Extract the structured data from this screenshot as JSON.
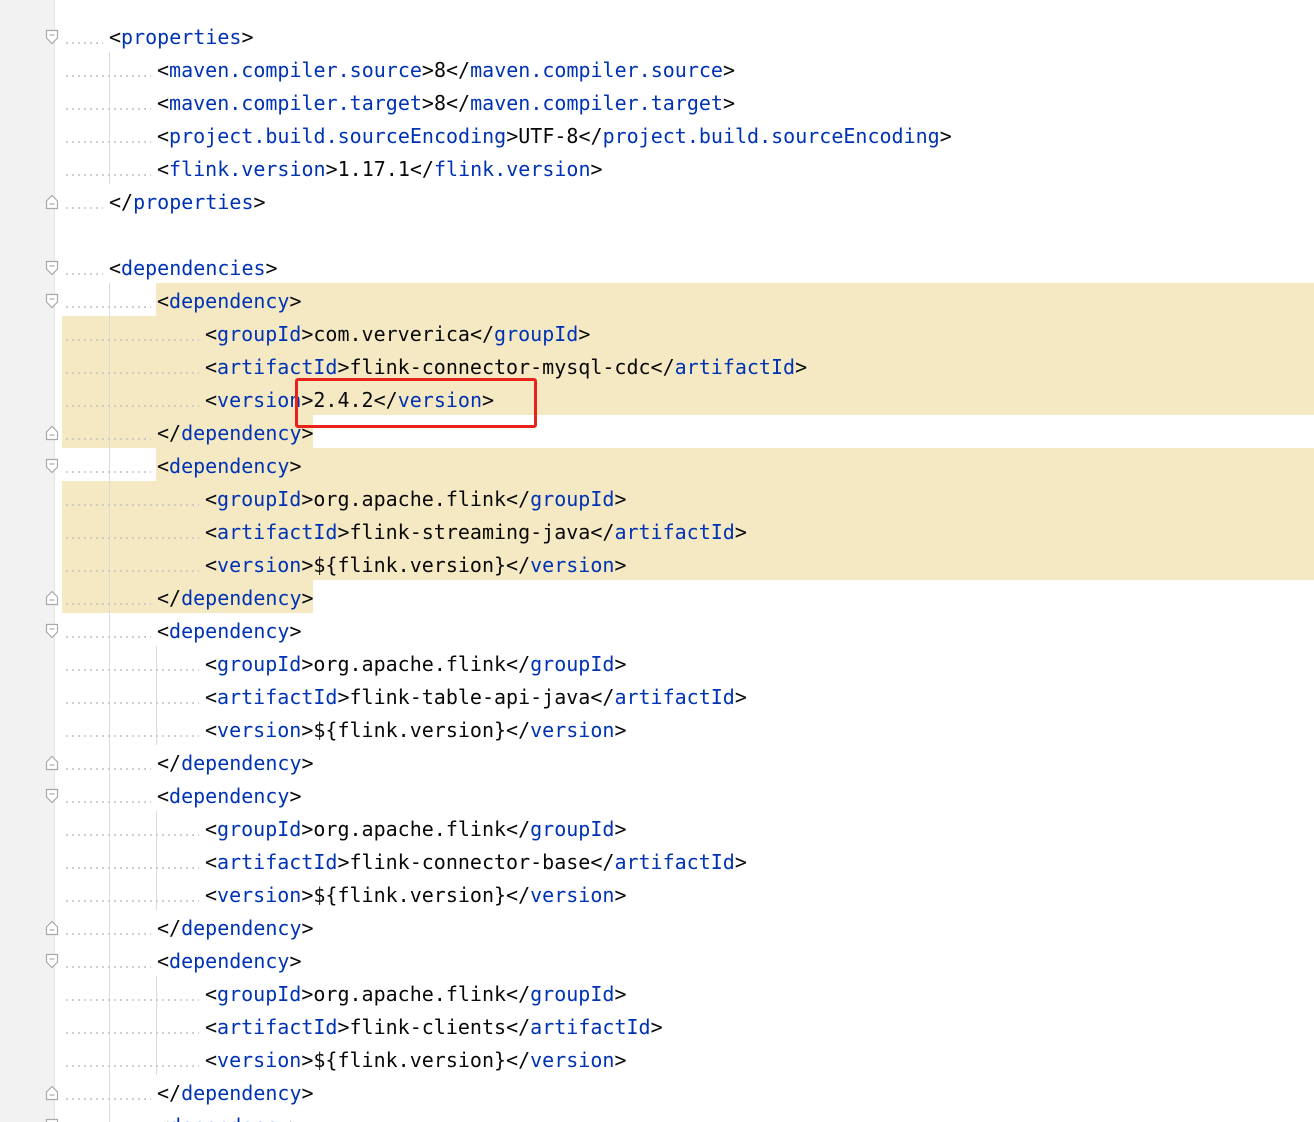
{
  "editor": {
    "language": "xml",
    "highlight_color": "#f5e9c4",
    "annotation_color": "#e8231a",
    "tag_color": "#0033b3",
    "text_color": "#080808",
    "lines": [
      {
        "indent": 1,
        "fold": "open",
        "parts": [
          {
            "t": "b",
            "v": "<"
          },
          {
            "t": "tag",
            "v": "properties"
          },
          {
            "t": "b",
            "v": ">"
          }
        ]
      },
      {
        "indent": 2,
        "fold": null,
        "parts": [
          {
            "t": "b",
            "v": "<"
          },
          {
            "t": "tag",
            "v": "maven.compiler.source"
          },
          {
            "t": "b",
            "v": ">"
          },
          {
            "t": "txt",
            "v": "8"
          },
          {
            "t": "b",
            "v": "</"
          },
          {
            "t": "tag",
            "v": "maven.compiler.source"
          },
          {
            "t": "b",
            "v": ">"
          }
        ]
      },
      {
        "indent": 2,
        "fold": null,
        "parts": [
          {
            "t": "b",
            "v": "<"
          },
          {
            "t": "tag",
            "v": "maven.compiler.target"
          },
          {
            "t": "b",
            "v": ">"
          },
          {
            "t": "txt",
            "v": "8"
          },
          {
            "t": "b",
            "v": "</"
          },
          {
            "t": "tag",
            "v": "maven.compiler.target"
          },
          {
            "t": "b",
            "v": ">"
          }
        ]
      },
      {
        "indent": 2,
        "fold": null,
        "parts": [
          {
            "t": "b",
            "v": "<"
          },
          {
            "t": "tag",
            "v": "project.build.sourceEncoding"
          },
          {
            "t": "b",
            "v": ">"
          },
          {
            "t": "txt",
            "v": "UTF-8"
          },
          {
            "t": "b",
            "v": "</"
          },
          {
            "t": "tag",
            "v": "project.build.sourceEncoding"
          },
          {
            "t": "b",
            "v": ">"
          }
        ]
      },
      {
        "indent": 2,
        "fold": null,
        "parts": [
          {
            "t": "b",
            "v": "<"
          },
          {
            "t": "tag",
            "v": "flink.version"
          },
          {
            "t": "b",
            "v": ">"
          },
          {
            "t": "txt",
            "v": "1.17.1"
          },
          {
            "t": "b",
            "v": "</"
          },
          {
            "t": "tag",
            "v": "flink.version"
          },
          {
            "t": "b",
            "v": ">"
          }
        ]
      },
      {
        "indent": 1,
        "fold": "close",
        "parts": [
          {
            "t": "b",
            "v": "</"
          },
          {
            "t": "tag",
            "v": "properties"
          },
          {
            "t": "b",
            "v": ">"
          }
        ]
      },
      {
        "indent": 0,
        "fold": null,
        "parts": []
      },
      {
        "indent": 1,
        "fold": "open",
        "parts": [
          {
            "t": "b",
            "v": "<"
          },
          {
            "t": "tag",
            "v": "dependencies"
          },
          {
            "t": "b",
            "v": ">"
          }
        ]
      },
      {
        "indent": 2,
        "fold": "open",
        "parts": [
          {
            "t": "b",
            "v": "<"
          },
          {
            "t": "tag",
            "v": "dependency"
          },
          {
            "t": "b",
            "v": ">"
          }
        ]
      },
      {
        "indent": 3,
        "fold": null,
        "parts": [
          {
            "t": "b",
            "v": "<"
          },
          {
            "t": "tag",
            "v": "groupId"
          },
          {
            "t": "b",
            "v": ">"
          },
          {
            "t": "txt",
            "v": "com.ververica"
          },
          {
            "t": "b",
            "v": "</"
          },
          {
            "t": "tag",
            "v": "groupId"
          },
          {
            "t": "b",
            "v": ">"
          }
        ]
      },
      {
        "indent": 3,
        "fold": null,
        "parts": [
          {
            "t": "b",
            "v": "<"
          },
          {
            "t": "tag",
            "v": "artifactId"
          },
          {
            "t": "b",
            "v": ">"
          },
          {
            "t": "txt",
            "v": "flink-connector-mysql-cdc"
          },
          {
            "t": "b",
            "v": "</"
          },
          {
            "t": "tag",
            "v": "artifactId"
          },
          {
            "t": "b",
            "v": ">"
          }
        ]
      },
      {
        "indent": 3,
        "fold": null,
        "parts": [
          {
            "t": "b",
            "v": "<"
          },
          {
            "t": "tag",
            "v": "version"
          },
          {
            "t": "b",
            "v": ">"
          },
          {
            "t": "txt",
            "v": "2.4.2"
          },
          {
            "t": "b",
            "v": "</"
          },
          {
            "t": "tag",
            "v": "version"
          },
          {
            "t": "b",
            "v": ">"
          }
        ]
      },
      {
        "indent": 2,
        "fold": "close",
        "parts": [
          {
            "t": "b",
            "v": "</"
          },
          {
            "t": "tag",
            "v": "dependency"
          },
          {
            "t": "b",
            "v": ">"
          }
        ]
      },
      {
        "indent": 2,
        "fold": "open",
        "parts": [
          {
            "t": "b",
            "v": "<"
          },
          {
            "t": "tag",
            "v": "dependency"
          },
          {
            "t": "b",
            "v": ">"
          }
        ]
      },
      {
        "indent": 3,
        "fold": null,
        "parts": [
          {
            "t": "b",
            "v": "<"
          },
          {
            "t": "tag",
            "v": "groupId"
          },
          {
            "t": "b",
            "v": ">"
          },
          {
            "t": "txt",
            "v": "org.apache.flink"
          },
          {
            "t": "b",
            "v": "</"
          },
          {
            "t": "tag",
            "v": "groupId"
          },
          {
            "t": "b",
            "v": ">"
          }
        ]
      },
      {
        "indent": 3,
        "fold": null,
        "parts": [
          {
            "t": "b",
            "v": "<"
          },
          {
            "t": "tag",
            "v": "artifactId"
          },
          {
            "t": "b",
            "v": ">"
          },
          {
            "t": "txt",
            "v": "flink-streaming-java"
          },
          {
            "t": "b",
            "v": "</"
          },
          {
            "t": "tag",
            "v": "artifactId"
          },
          {
            "t": "b",
            "v": ">"
          }
        ]
      },
      {
        "indent": 3,
        "fold": null,
        "parts": [
          {
            "t": "b",
            "v": "<"
          },
          {
            "t": "tag",
            "v": "version"
          },
          {
            "t": "b",
            "v": ">"
          },
          {
            "t": "txt",
            "v": "${flink.version}"
          },
          {
            "t": "b",
            "v": "</"
          },
          {
            "t": "tag",
            "v": "version"
          },
          {
            "t": "b",
            "v": ">"
          }
        ]
      },
      {
        "indent": 2,
        "fold": "close",
        "parts": [
          {
            "t": "b",
            "v": "</"
          },
          {
            "t": "tag",
            "v": "dependency"
          },
          {
            "t": "b",
            "v": ">"
          }
        ]
      },
      {
        "indent": 2,
        "fold": "open",
        "parts": [
          {
            "t": "b",
            "v": "<"
          },
          {
            "t": "tag",
            "v": "dependency"
          },
          {
            "t": "b",
            "v": ">"
          }
        ]
      },
      {
        "indent": 3,
        "fold": null,
        "parts": [
          {
            "t": "b",
            "v": "<"
          },
          {
            "t": "tag",
            "v": "groupId"
          },
          {
            "t": "b",
            "v": ">"
          },
          {
            "t": "txt",
            "v": "org.apache.flink"
          },
          {
            "t": "b",
            "v": "</"
          },
          {
            "t": "tag",
            "v": "groupId"
          },
          {
            "t": "b",
            "v": ">"
          }
        ]
      },
      {
        "indent": 3,
        "fold": null,
        "parts": [
          {
            "t": "b",
            "v": "<"
          },
          {
            "t": "tag",
            "v": "artifactId"
          },
          {
            "t": "b",
            "v": ">"
          },
          {
            "t": "txt",
            "v": "flink-table-api-java"
          },
          {
            "t": "b",
            "v": "</"
          },
          {
            "t": "tag",
            "v": "artifactId"
          },
          {
            "t": "b",
            "v": ">"
          }
        ]
      },
      {
        "indent": 3,
        "fold": null,
        "parts": [
          {
            "t": "b",
            "v": "<"
          },
          {
            "t": "tag",
            "v": "version"
          },
          {
            "t": "b",
            "v": ">"
          },
          {
            "t": "txt",
            "v": "${flink.version}"
          },
          {
            "t": "b",
            "v": "</"
          },
          {
            "t": "tag",
            "v": "version"
          },
          {
            "t": "b",
            "v": ">"
          }
        ]
      },
      {
        "indent": 2,
        "fold": "close",
        "parts": [
          {
            "t": "b",
            "v": "</"
          },
          {
            "t": "tag",
            "v": "dependency"
          },
          {
            "t": "b",
            "v": ">"
          }
        ]
      },
      {
        "indent": 2,
        "fold": "open",
        "parts": [
          {
            "t": "b",
            "v": "<"
          },
          {
            "t": "tag",
            "v": "dependency"
          },
          {
            "t": "b",
            "v": ">"
          }
        ]
      },
      {
        "indent": 3,
        "fold": null,
        "parts": [
          {
            "t": "b",
            "v": "<"
          },
          {
            "t": "tag",
            "v": "groupId"
          },
          {
            "t": "b",
            "v": ">"
          },
          {
            "t": "txt",
            "v": "org.apache.flink"
          },
          {
            "t": "b",
            "v": "</"
          },
          {
            "t": "tag",
            "v": "groupId"
          },
          {
            "t": "b",
            "v": ">"
          }
        ]
      },
      {
        "indent": 3,
        "fold": null,
        "parts": [
          {
            "t": "b",
            "v": "<"
          },
          {
            "t": "tag",
            "v": "artifactId"
          },
          {
            "t": "b",
            "v": ">"
          },
          {
            "t": "txt",
            "v": "flink-connector-base"
          },
          {
            "t": "b",
            "v": "</"
          },
          {
            "t": "tag",
            "v": "artifactId"
          },
          {
            "t": "b",
            "v": ">"
          }
        ]
      },
      {
        "indent": 3,
        "fold": null,
        "parts": [
          {
            "t": "b",
            "v": "<"
          },
          {
            "t": "tag",
            "v": "version"
          },
          {
            "t": "b",
            "v": ">"
          },
          {
            "t": "txt",
            "v": "${flink.version}"
          },
          {
            "t": "b",
            "v": "</"
          },
          {
            "t": "tag",
            "v": "version"
          },
          {
            "t": "b",
            "v": ">"
          }
        ]
      },
      {
        "indent": 2,
        "fold": "close",
        "parts": [
          {
            "t": "b",
            "v": "</"
          },
          {
            "t": "tag",
            "v": "dependency"
          },
          {
            "t": "b",
            "v": ">"
          }
        ]
      },
      {
        "indent": 2,
        "fold": "open",
        "parts": [
          {
            "t": "b",
            "v": "<"
          },
          {
            "t": "tag",
            "v": "dependency"
          },
          {
            "t": "b",
            "v": ">"
          }
        ]
      },
      {
        "indent": 3,
        "fold": null,
        "parts": [
          {
            "t": "b",
            "v": "<"
          },
          {
            "t": "tag",
            "v": "groupId"
          },
          {
            "t": "b",
            "v": ">"
          },
          {
            "t": "txt",
            "v": "org.apache.flink"
          },
          {
            "t": "b",
            "v": "</"
          },
          {
            "t": "tag",
            "v": "groupId"
          },
          {
            "t": "b",
            "v": ">"
          }
        ]
      },
      {
        "indent": 3,
        "fold": null,
        "parts": [
          {
            "t": "b",
            "v": "<"
          },
          {
            "t": "tag",
            "v": "artifactId"
          },
          {
            "t": "b",
            "v": ">"
          },
          {
            "t": "txt",
            "v": "flink-clients"
          },
          {
            "t": "b",
            "v": "</"
          },
          {
            "t": "tag",
            "v": "artifactId"
          },
          {
            "t": "b",
            "v": ">"
          }
        ]
      },
      {
        "indent": 3,
        "fold": null,
        "parts": [
          {
            "t": "b",
            "v": "<"
          },
          {
            "t": "tag",
            "v": "version"
          },
          {
            "t": "b",
            "v": ">"
          },
          {
            "t": "txt",
            "v": "${flink.version}"
          },
          {
            "t": "b",
            "v": "</"
          },
          {
            "t": "tag",
            "v": "version"
          },
          {
            "t": "b",
            "v": ">"
          }
        ]
      },
      {
        "indent": 2,
        "fold": "close",
        "parts": [
          {
            "t": "b",
            "v": "</"
          },
          {
            "t": "tag",
            "v": "dependency"
          },
          {
            "t": "b",
            "v": ">"
          }
        ]
      },
      {
        "indent": 2,
        "fold": "open",
        "parts": [
          {
            "t": "b",
            "v": "<"
          },
          {
            "t": "tag",
            "v": "dependency"
          },
          {
            "t": "b",
            "v": ">"
          }
        ]
      }
    ]
  }
}
